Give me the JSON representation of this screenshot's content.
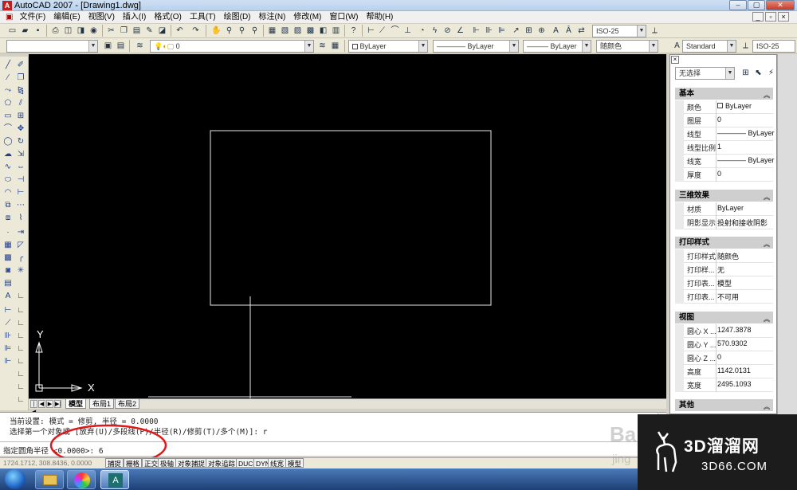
{
  "window": {
    "title": "AutoCAD 2007 - [Drawing1.dwg]",
    "app_icon_label": "A"
  },
  "menubar": {
    "items": [
      "文件(F)",
      "编辑(E)",
      "视图(V)",
      "插入(I)",
      "格式(O)",
      "工具(T)",
      "绘图(D)",
      "标注(N)",
      "修改(M)",
      "窗口(W)",
      "帮助(H)"
    ]
  },
  "toolbar": {
    "dimstyle_combo": "ISO-25",
    "layer_combo": "0",
    "color_combo": "ByLayer",
    "linetype_combo": "ByLayer",
    "lineweight_combo": "ByLayer",
    "plotstyle_combo": "随颜色",
    "textstyle_combo": "Standard",
    "dimstyle_combo2": "ISO-25"
  },
  "tabs": {
    "model": "模型",
    "layout1": "布局1",
    "layout2": "布局2"
  },
  "ucs": {
    "x_label": "X",
    "y_label": "Y"
  },
  "command": {
    "line1": "当前设置: 模式 = 修剪, 半径 = 0.0000",
    "line2": "选择第一个对象或 [放弃(U)/多段线(P)/半径(R)/修剪(T)/多个(M)]: r",
    "prompt": "指定圆角半径 <0.0000>: 6"
  },
  "status": {
    "coords": "1724.1712, 308.8436, 0.0000",
    "toggles": [
      "捕捉",
      "栅格",
      "正交",
      "极轴",
      "对象捕捉",
      "对象追踪",
      "DUCS",
      "DYN",
      "线宽",
      "模型"
    ]
  },
  "properties": {
    "selection": "无选择",
    "sections": [
      {
        "title": "基本",
        "rows": [
          {
            "label": "颜色",
            "value": "ByLayer",
            "swatch": true
          },
          {
            "label": "图层",
            "value": "0"
          },
          {
            "label": "线型",
            "value": "———— ByLayer"
          },
          {
            "label": "线型比例",
            "value": "1"
          },
          {
            "label": "线宽",
            "value": "———— ByLayer"
          },
          {
            "label": "厚度",
            "value": "0"
          }
        ]
      },
      {
        "title": "三维效果",
        "rows": [
          {
            "label": "材质",
            "value": "ByLayer"
          },
          {
            "label": "阴影显示",
            "value": "投射和接收阴影"
          }
        ]
      },
      {
        "title": "打印样式",
        "rows": [
          {
            "label": "打印样式",
            "value": "随颜色"
          },
          {
            "label": "打印样...",
            "value": "无"
          },
          {
            "label": "打印表...",
            "value": "模型"
          },
          {
            "label": "打印表...",
            "value": "不可用"
          }
        ]
      },
      {
        "title": "视图",
        "rows": [
          {
            "label": "圆心 X ...",
            "value": "1247.3878"
          },
          {
            "label": "圆心 Y ...",
            "value": "570.9302"
          },
          {
            "label": "圆心 Z ...",
            "value": "0"
          },
          {
            "label": "高度",
            "value": "1142.0131"
          },
          {
            "label": "宽度",
            "value": "2495.1093"
          }
        ]
      },
      {
        "title": "其他",
        "rows": []
      }
    ]
  },
  "watermark": {
    "line1": "3D溜溜网",
    "line2": "3D66.COM",
    "faint1": "Ba",
    "faint2": "jing"
  }
}
